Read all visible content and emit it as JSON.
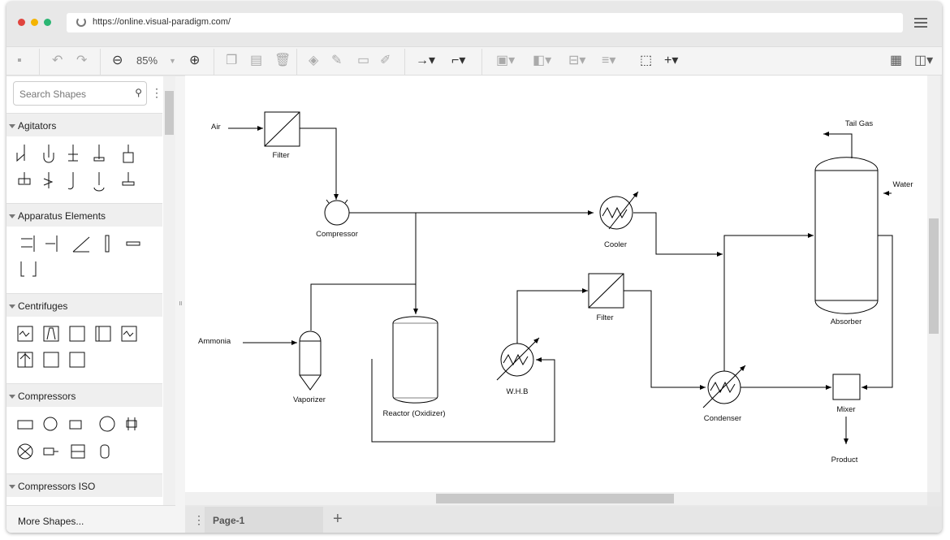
{
  "browser": {
    "url": "https://online.visual-paradigm.com/"
  },
  "toolbar": {
    "zoom": "85%"
  },
  "sidebar": {
    "search_placeholder": "Search Shapes",
    "categories": [
      {
        "label": "Agitators"
      },
      {
        "label": "Apparatus Elements"
      },
      {
        "label": "Centrifuges"
      },
      {
        "label": "Compressors"
      },
      {
        "label": "Compressors ISO"
      }
    ],
    "more_shapes": "More Shapes..."
  },
  "diagram": {
    "air": "Air",
    "filter1": "Filter",
    "compressor": "Compressor",
    "cooler": "Cooler",
    "tail_gas": "Tail Gas",
    "water": "Water",
    "absorber": "Absorber",
    "ammonia": "Ammonia",
    "vaporizer": "Vaporizer",
    "reactor": "Reactor (Oxidizer)",
    "whb": "W.H.B",
    "filter2": "Filter",
    "condenser": "Condenser",
    "mixer": "Mixer",
    "product": "Product"
  },
  "tabs": {
    "page": "Page-1"
  },
  "colors": {
    "close": "#e0443e",
    "minimize": "#f4b400",
    "maximize": "#2bb673"
  }
}
